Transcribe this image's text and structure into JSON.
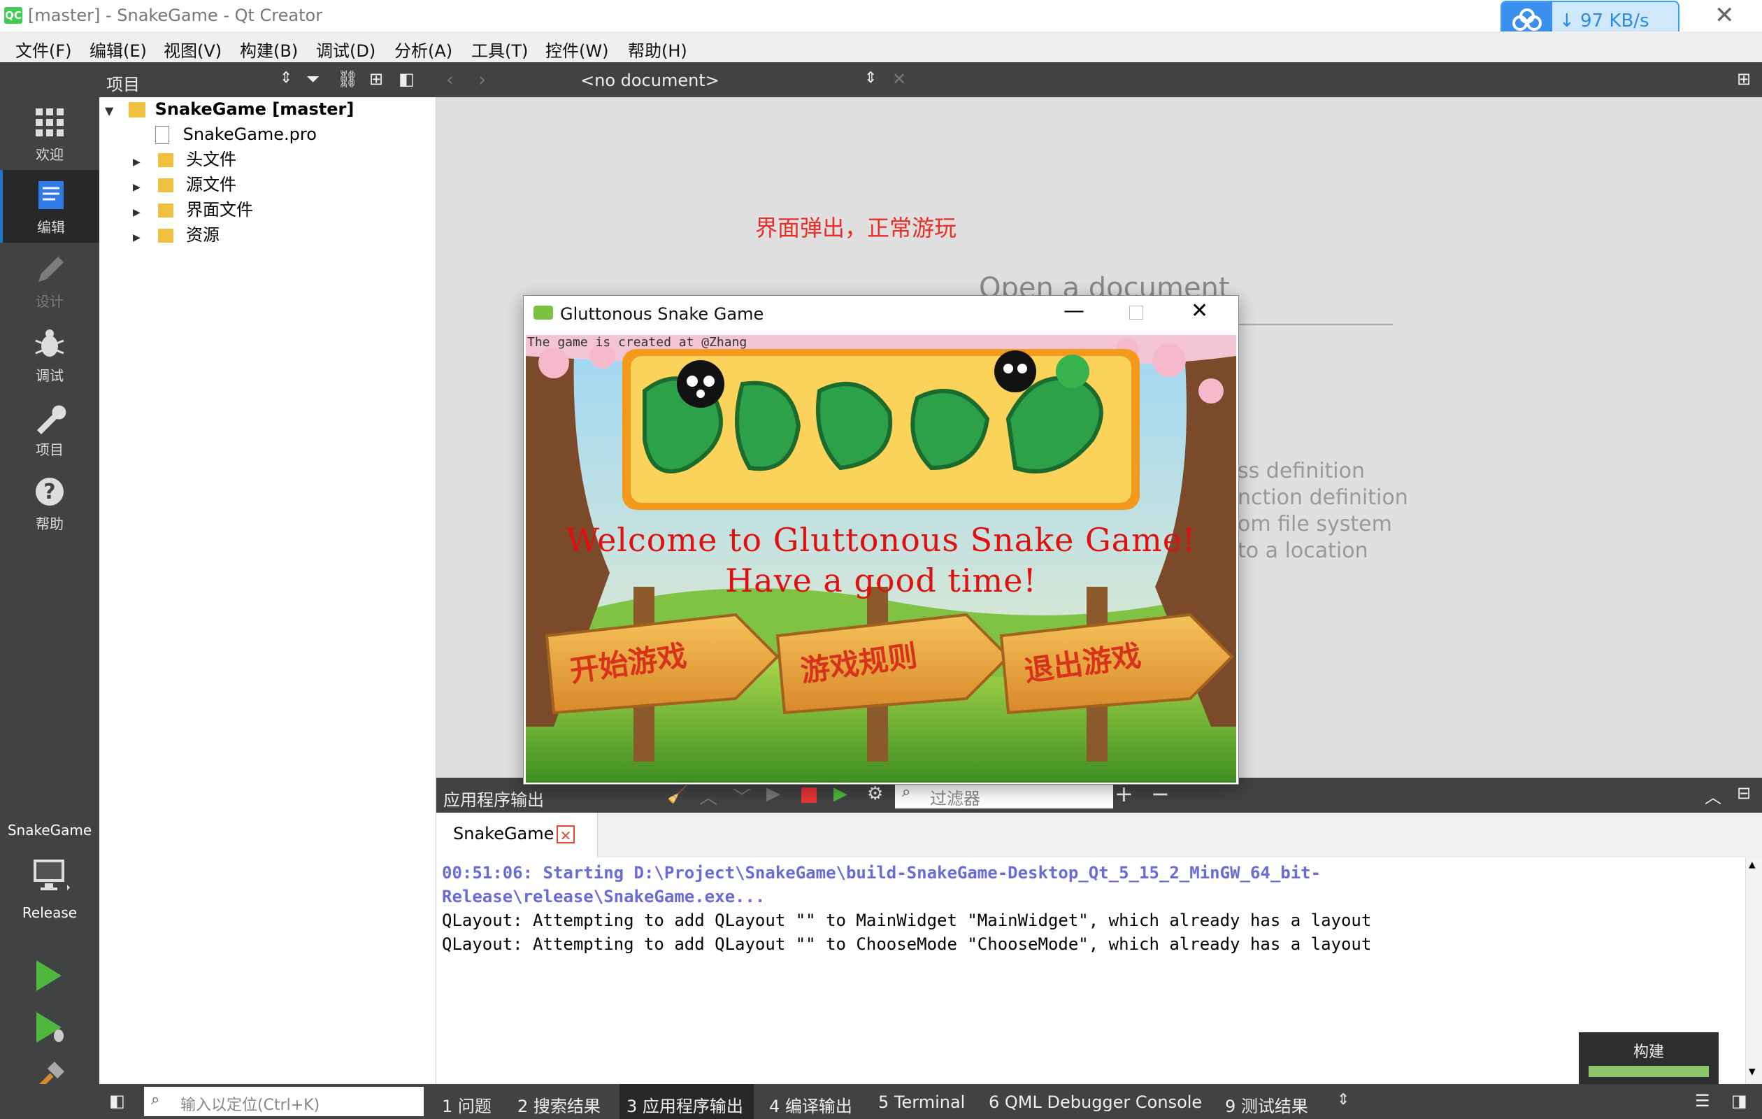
{
  "window": {
    "icon": "QC",
    "title": "[master] - SnakeGame - Qt Creator"
  },
  "network": {
    "speed": "↓ 97 KB/s"
  },
  "menu": [
    "文件(F)",
    "编辑(E)",
    "视图(V)",
    "构建(B)",
    "调试(D)",
    "分析(A)",
    "工具(T)",
    "控件(W)",
    "帮助(H)"
  ],
  "modes": [
    {
      "label": "欢迎",
      "icon": "grid-icon"
    },
    {
      "label": "编辑",
      "icon": "edit-doc-icon"
    },
    {
      "label": "设计",
      "icon": "pencil-icon"
    },
    {
      "label": "调试",
      "icon": "bug-icon"
    },
    {
      "label": "项目",
      "icon": "wrench-icon"
    },
    {
      "label": "帮助",
      "icon": "help-icon"
    }
  ],
  "kit": {
    "project": "SnakeGame",
    "config": "Release"
  },
  "projects_pane": {
    "title": "项目"
  },
  "tree": {
    "root": "SnakeGame [master]",
    "items": [
      "SnakeGame.pro",
      "头文件",
      "源文件",
      "界面文件",
      "资源"
    ]
  },
  "editor": {
    "doc_selector": "<no document>",
    "annotation": "界面弹出，正常游玩",
    "open_doc": "Open a document",
    "hints": [
      "ss definition",
      "nction definition",
      "om file system",
      "to a location"
    ]
  },
  "game": {
    "title": "Gluttonous Snake Game",
    "credit": "The game is created at @Zhang",
    "welcome1": "Welcome to Gluttonous Snake Game!",
    "welcome2": "Have a good time!",
    "buttons": [
      "开始游戏",
      "游戏规则",
      "退出游戏"
    ]
  },
  "output": {
    "title": "应用程序输出",
    "filter_placeholder": "过滤器",
    "tab": "SnakeGame",
    "lines": [
      "00:51:06: Starting D:\\Project\\SnakeGame\\build-SnakeGame-Desktop_Qt_5_15_2_MinGW_64_bit-",
      "Release\\release\\SnakeGame.exe...",
      "QLayout: Attempting to add QLayout \"\" to MainWidget \"MainWidget\", which already has a layout",
      "QLayout: Attempting to add QLayout \"\" to ChooseMode \"ChooseMode\", which already has a layout"
    ]
  },
  "build_popup": {
    "label": "构建",
    "progress": 1.0
  },
  "statusbar": {
    "locator_placeholder": "输入以定位(Ctrl+K)",
    "tabs": [
      "1  问题",
      "2  搜索结果",
      "3  应用程序输出",
      "4  编译输出",
      "5  Terminal",
      "6  QML Debugger Console",
      "9  测试结果"
    ]
  },
  "colors": {
    "dark": "#404244",
    "accent": "#1f75cc",
    "run": "#4fb83c",
    "annotation": "#e8302a",
    "starting": "#6b6bd8"
  }
}
